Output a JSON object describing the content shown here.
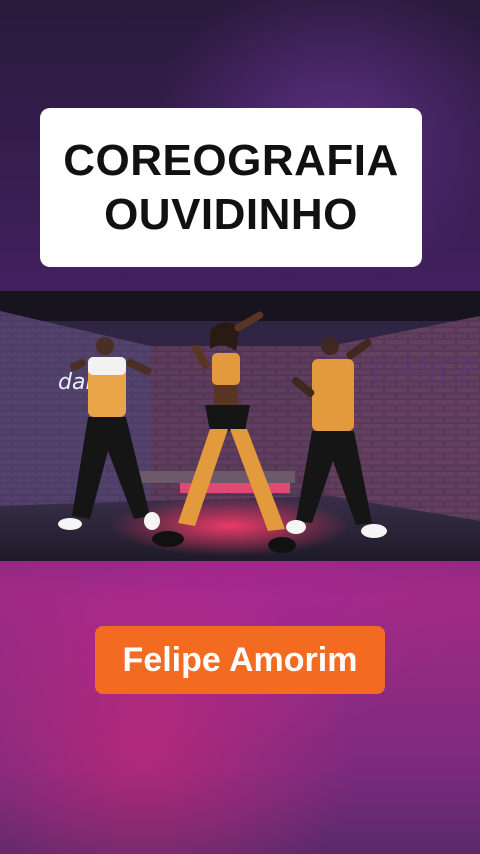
{
  "title": {
    "line1": "COREOGRAFIA",
    "line2": "OUVIDINHO"
  },
  "photo": {
    "description_icon": "dance-video-frame",
    "sign_text": "dance"
  },
  "artist": {
    "name": "Felipe Amorim",
    "badge_color": "#f36a21"
  }
}
